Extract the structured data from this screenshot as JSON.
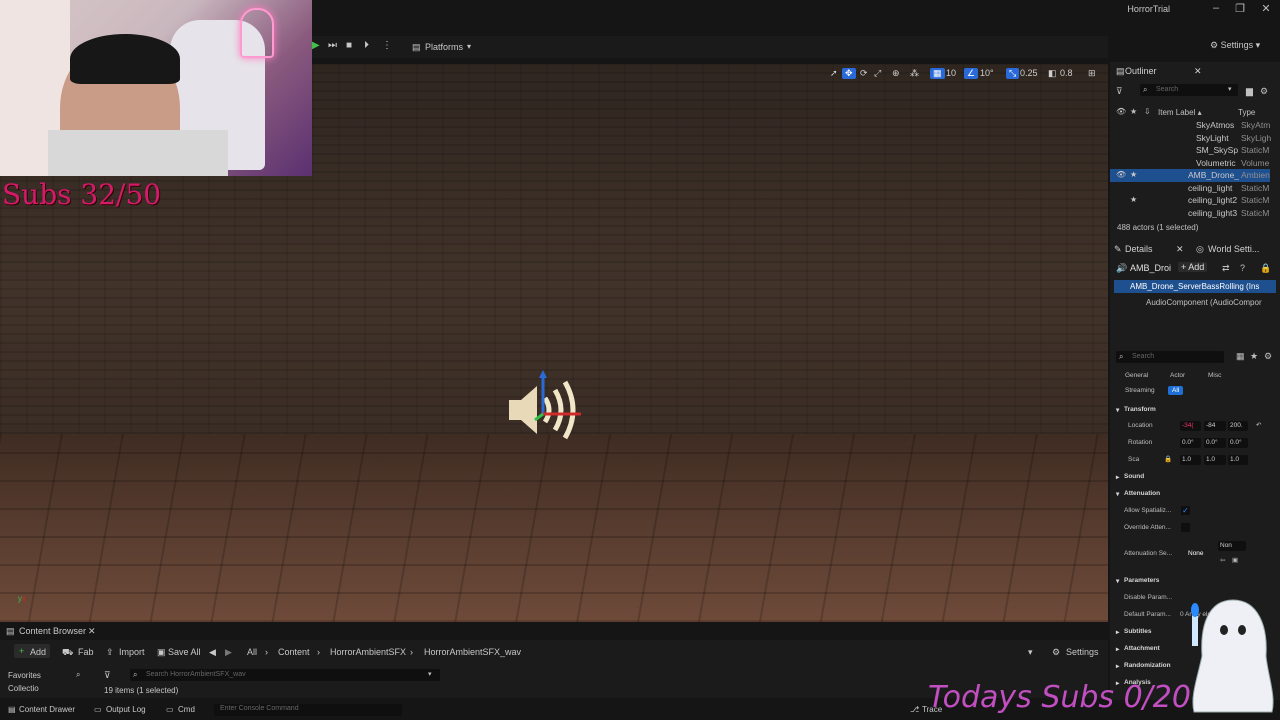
{
  "window": {
    "title": "HorrorTrial",
    "controls": [
      "–",
      "❐",
      "✕"
    ]
  },
  "toolbar": {
    "platforms_label": "Platforms",
    "settings_label": "Settings"
  },
  "viewport_toolbar": {
    "grid": "10",
    "angle": "10°",
    "scale": "0.25",
    "camera": "0.8"
  },
  "overlay": {
    "subs": "Subs 32/50",
    "today_subs": "Todays Subs 0/20"
  },
  "outliner": {
    "tab": "Outliner",
    "search_placeholder": "Search",
    "col_label": "Item Label ▴",
    "col_type": "Type",
    "rows": [
      {
        "name": "SkyAtmos",
        "type": "SkyAtm",
        "selected": false
      },
      {
        "name": "SkyLight",
        "type": "SkyLigh",
        "selected": false
      },
      {
        "name": "SM_SkySp",
        "type": "StaticM",
        "selected": false
      },
      {
        "name": "Volumetric",
        "type": "Volume",
        "selected": false
      },
      {
        "name": "AMB_Drone_",
        "type": "Ambien",
        "selected": true
      },
      {
        "name": "ceiling_light",
        "type": "StaticM",
        "selected": false
      },
      {
        "name": "ceiling_light2",
        "type": "StaticM",
        "selected": false
      },
      {
        "name": "ceiling_light3",
        "type": "StaticM",
        "selected": false
      }
    ],
    "status": "488 actors (1 selected)"
  },
  "details": {
    "tab": "Details",
    "tab2": "World Setti...",
    "actor_name": "AMB_Droi",
    "add_label": "+ Add",
    "component_root": "AMB_Drone_ServerBassRolling (Ins",
    "component_child": "AudioComponent (AudioCompor",
    "search_placeholder": "Search",
    "filters": [
      "General",
      "Actor",
      "Misc",
      "Streaming",
      "All"
    ],
    "transform_section": "Transform",
    "location_label": "Location",
    "location": [
      "-34(",
      "-84",
      "200."
    ],
    "rotation_label": "Rotation",
    "rotation": [
      "0.0°",
      "0.0°",
      "0.0°"
    ],
    "scale_label": "Sca",
    "scale": [
      "1.0",
      "1.0",
      "1.0"
    ],
    "sound_section": "Sound",
    "attenuation_section": "Attenuation",
    "allow_spatial": "Allow Spatializ...",
    "override_atten": "Override Atten...",
    "attenuation_settings": "Attenuation Se...",
    "attenuation_value": "None",
    "attenuation_dropdown": "Non",
    "parameters_section": "Parameters",
    "disable_param": "Disable Param...",
    "default_param": "Default Param...",
    "default_param_value": "0 Array elem",
    "subtitles_section": "Subtitles",
    "attachment_section": "Attachment",
    "randomization_section": "Randomization",
    "analysis_section": "Analysis"
  },
  "content_browser": {
    "tab": "Content Browser",
    "add": "Add",
    "fab": "Fab",
    "import": "Import",
    "save_all": "Save All",
    "breadcrumbs": [
      "All",
      "Content",
      "HorrorAmbientSFX",
      "HorrorAmbientSFX_wav"
    ],
    "settings": "Settings",
    "favorites": "Favorites",
    "collections": "Collectio",
    "search_placeholder": "Search HorrorAmbientSFX_wav",
    "item_count": "19 items (1 selected)"
  },
  "bottom_bar": {
    "content_drawer": "Content Drawer",
    "output_log": "Output Log",
    "cmd": "Cmd",
    "console_placeholder": "Enter Console Command",
    "trace": "Trace"
  }
}
